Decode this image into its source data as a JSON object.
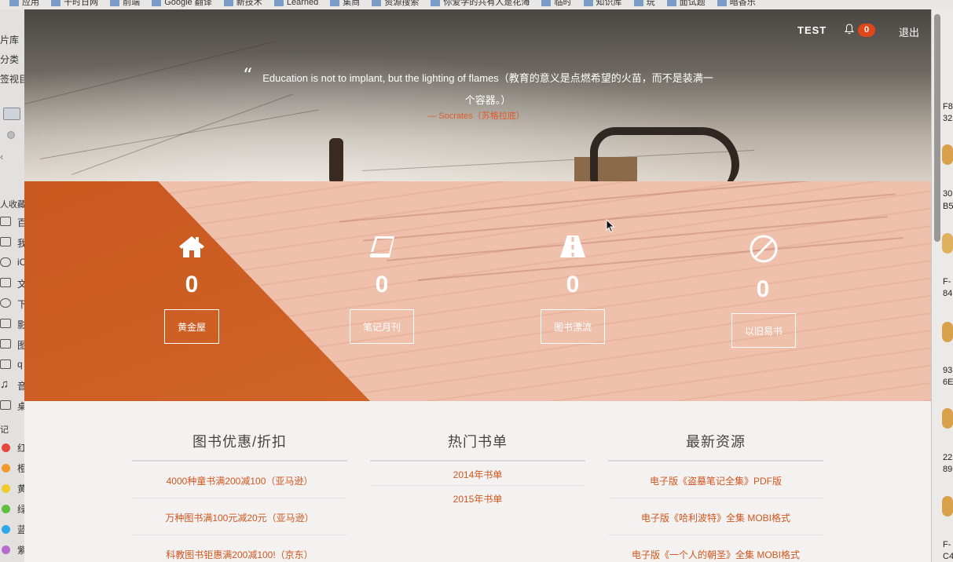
{
  "browser": {
    "bookmarks": [
      "应用",
      "干时日网",
      "前端",
      "Google 翻译",
      "新技术",
      "Learned",
      "集商",
      "资源搜索",
      "你爱学的共有人是花海",
      "临时",
      "知识库",
      "玩",
      "面试题",
      "暗香乐"
    ]
  },
  "finder_sidebar": {
    "top_labels": [
      "片库",
      "分类",
      "签视目"
    ],
    "section_personal": "人收藏",
    "items": [
      "百",
      "我",
      "iC",
      "文",
      "下",
      "影",
      "图",
      "q",
      "音",
      "桌"
    ],
    "tags_header": "记",
    "tags": [
      {
        "label": "红",
        "color": "#e5473c"
      },
      {
        "label": "橙",
        "color": "#f19a2b"
      },
      {
        "label": "黄",
        "color": "#f0c92a"
      },
      {
        "label": "绿",
        "color": "#5fc040"
      },
      {
        "label": "蓝",
        "color": "#2ea9e6"
      },
      {
        "label": "紫",
        "color": "#b86ad0"
      }
    ]
  },
  "right_sliver": {
    "fragments": [
      "F8",
      "32",
      "30",
      "B5",
      "F-",
      "84",
      "93",
      "6E",
      "22",
      "89",
      "F-",
      "C4"
    ]
  },
  "nav": {
    "user": "TEST",
    "notifications_count": "0",
    "logout": "退出"
  },
  "quote": {
    "mark": "“",
    "text": "Education is not to implant, but the lighting of flames（教育的意义是点燃希望的火苗，而不是装满一个容器。）",
    "author": "— Socrates（苏格拉底）"
  },
  "stats": [
    {
      "icon": "home-icon",
      "count": "0",
      "button": "黄金屋"
    },
    {
      "icon": "book-icon",
      "count": "0",
      "button": "笔记月刊"
    },
    {
      "icon": "road-icon",
      "count": "0",
      "button": "图书漂流"
    },
    {
      "icon": "ban-icon",
      "count": "0",
      "button": "以旧易书"
    }
  ],
  "lists": [
    {
      "title": "图书优惠/折扣",
      "items": [
        "4000种童书满200减100（亚马逊）",
        "万种图书满100元减20元（亚马逊）",
        "科教图书钜惠满200减100!（京东）"
      ]
    },
    {
      "title": "热门书单",
      "items": [
        "2014年书单",
        "2015年书单"
      ]
    },
    {
      "title": "最新资源",
      "items": [
        "电子版《盗墓笔记全集》PDF版",
        "电子版《哈利波特》全集 MOBI格式",
        "电子版《一个人的朝圣》全集 MOBI格式"
      ]
    }
  ],
  "colors": {
    "accent": "#d1561f",
    "badge": "#e0471b",
    "stats_orange": "#d46a2a",
    "stats_peach": "#efc0ac"
  }
}
